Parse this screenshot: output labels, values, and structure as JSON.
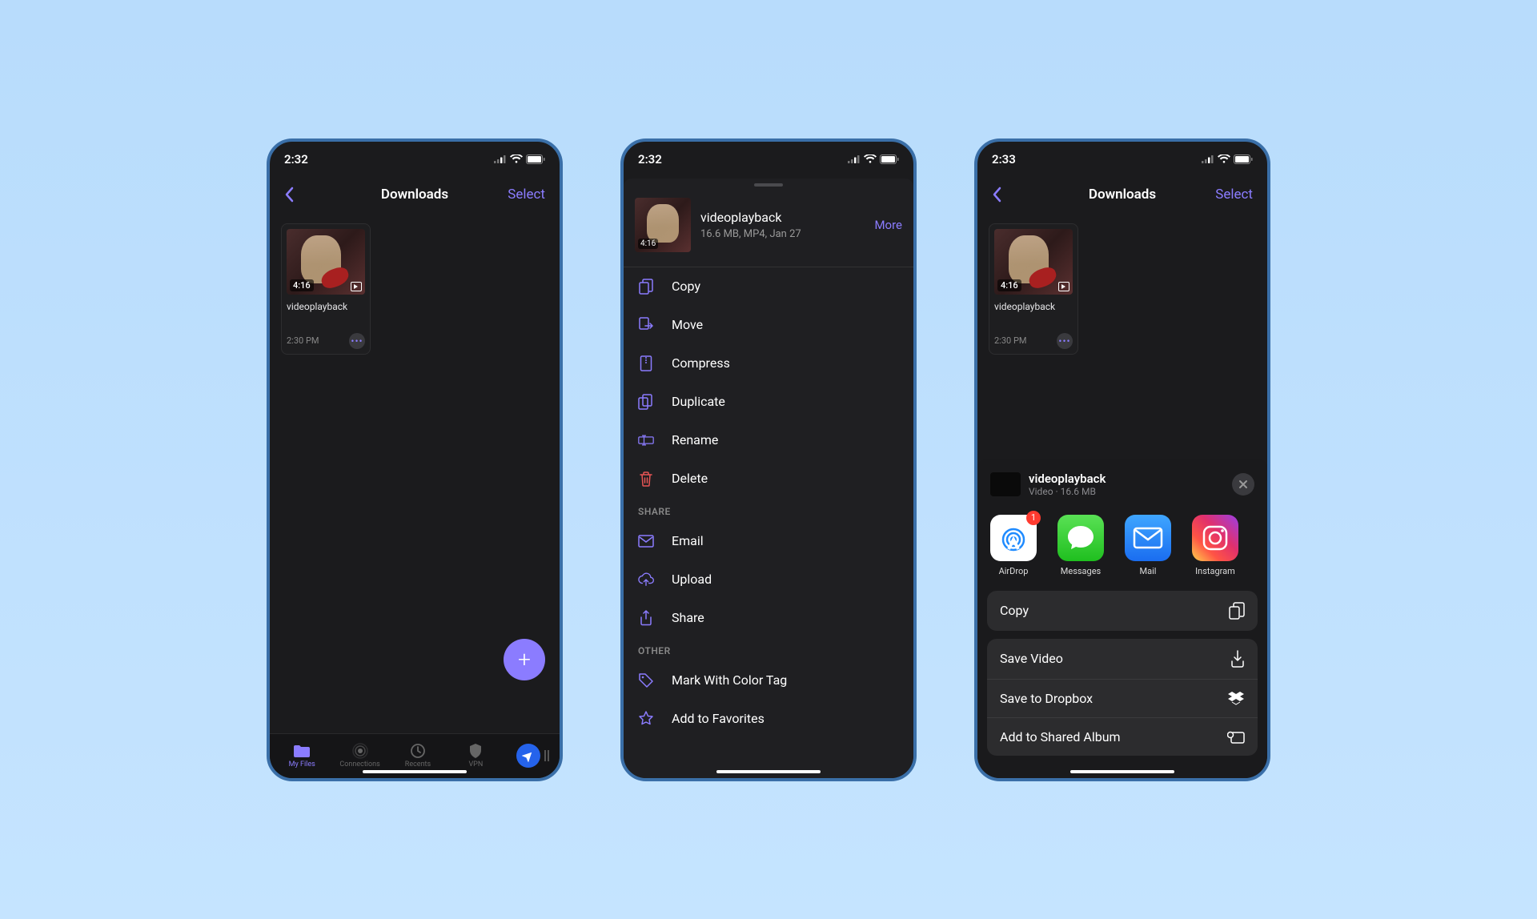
{
  "screen1": {
    "status_time": "2:32",
    "title": "Downloads",
    "select": "Select",
    "file": {
      "name": "videoplayback",
      "duration": "4:16",
      "time": "2:30 PM"
    },
    "tabs": {
      "myfiles": "My Files",
      "connections": "Connections",
      "recents": "Recents",
      "vpn": "VPN"
    }
  },
  "screen2": {
    "status_time": "2:32",
    "file": {
      "name": "videoplayback",
      "meta": "16.6 MB, MP4, Jan 27",
      "duration": "4:16"
    },
    "more": "More",
    "actions": {
      "copy": "Copy",
      "move": "Move",
      "compress": "Compress",
      "duplicate": "Duplicate",
      "rename": "Rename",
      "delete": "Delete"
    },
    "share_section": "SHARE",
    "share": {
      "email": "Email",
      "upload": "Upload",
      "share": "Share"
    },
    "other_section": "OTHER",
    "other": {
      "colortag": "Mark With Color Tag",
      "favorite": "Add to Favorites"
    }
  },
  "screen3": {
    "status_time": "2:33",
    "title": "Downloads",
    "select": "Select",
    "file": {
      "name": "videoplayback",
      "duration": "4:16",
      "time": "2:30 PM"
    },
    "share_header": {
      "name": "videoplayback",
      "meta": "Video · 16.6 MB"
    },
    "apps": {
      "airdrop": {
        "label": "AirDrop",
        "badge": "1"
      },
      "messages": {
        "label": "Messages"
      },
      "mail": {
        "label": "Mail"
      },
      "instagram": {
        "label": "Instagram"
      }
    },
    "actions": {
      "copy": "Copy",
      "save_video": "Save Video",
      "save_dropbox": "Save to Dropbox",
      "shared_album": "Add to Shared Album"
    }
  }
}
